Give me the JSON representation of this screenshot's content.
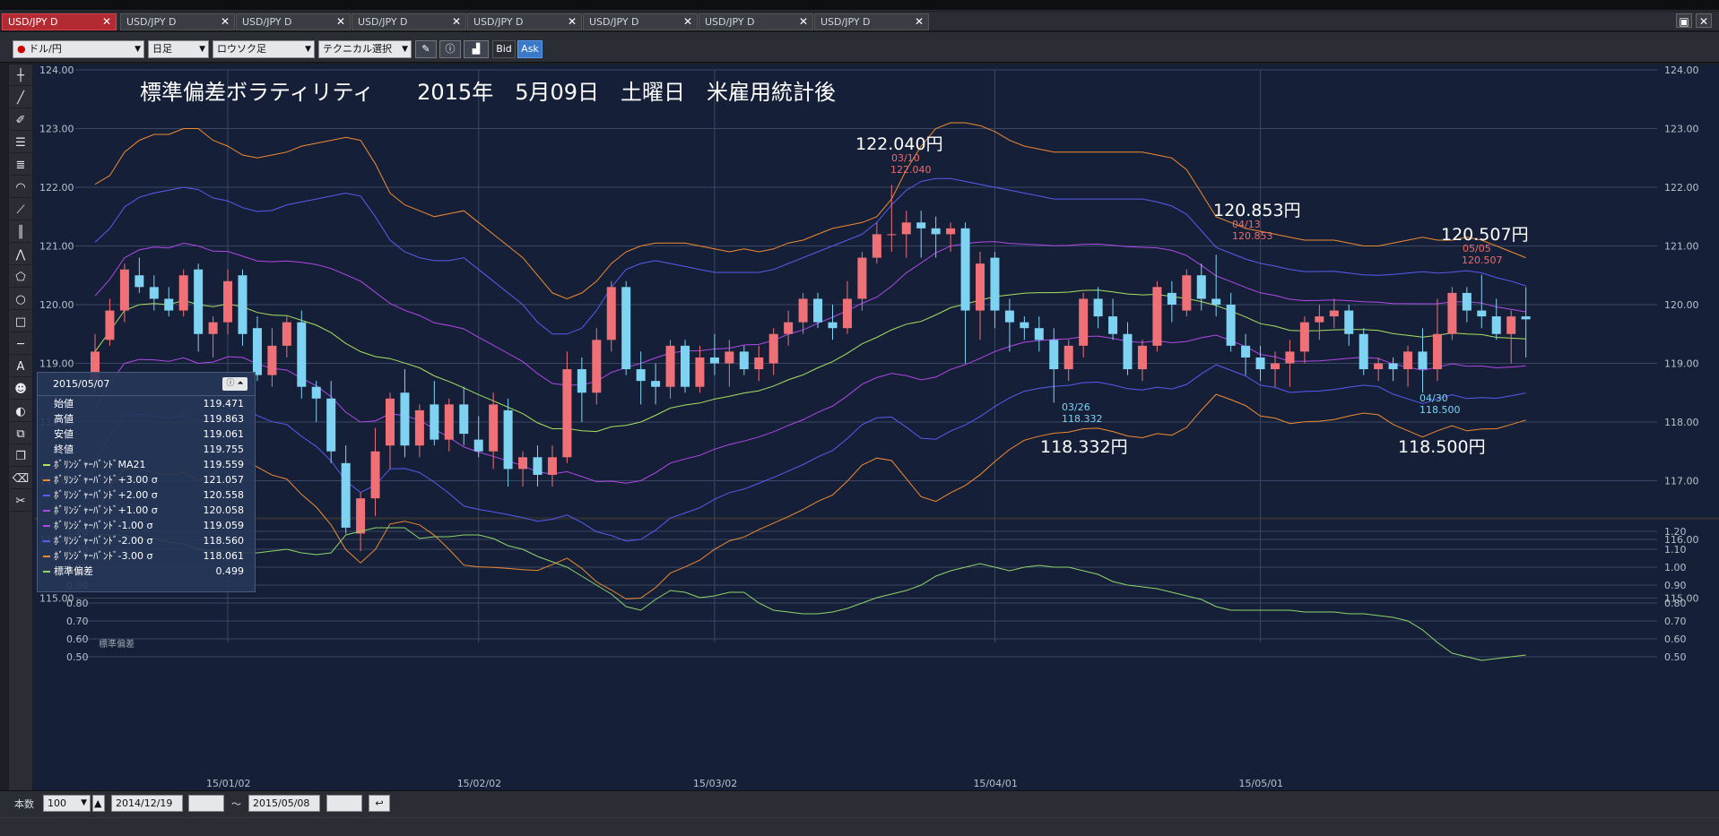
{
  "tabs": [
    {
      "label": "USD/JPY D",
      "active": true
    },
    {
      "label": "USD/JPY D",
      "active": false
    },
    {
      "label": "USD/JPY D",
      "active": false
    },
    {
      "label": "USD/JPY D",
      "active": false
    },
    {
      "label": "USD/JPY D",
      "active": false
    },
    {
      "label": "USD/JPY D",
      "active": false
    },
    {
      "label": "USD/JPY D",
      "active": false
    },
    {
      "label": "USD/JPY D",
      "active": false
    }
  ],
  "toolbar": {
    "pair": "ドル/円",
    "timeframe": "日足",
    "chart_type": "ロウソク足",
    "technical": "テクニカル選択",
    "bid_label": "Bid",
    "ask_label": "Ask"
  },
  "chart": {
    "title": "標準偏差ボラティリティ　　2015年　5月09日　土曜日　米雇用統計後",
    "price_ticks": [
      "124.00",
      "123.00",
      "122.00",
      "121.00",
      "120.00",
      "119.00",
      "118.00",
      "117.00",
      "116.00",
      "115.00"
    ],
    "sub_ticks": [
      "1.20",
      "1.10",
      "1.00",
      "0.90",
      "0.80",
      "0.70",
      "0.60",
      "0.50"
    ],
    "sub_label": "標準偏差",
    "date_ticks": [
      "15/01/02",
      "15/02/02",
      "15/03/02",
      "15/04/01",
      "15/05/01"
    ],
    "annotations": {
      "high1": {
        "big": "122.040円",
        "date": "03/10",
        "value": "122.040"
      },
      "low1": {
        "big": "118.332円",
        "date": "03/26",
        "value": "118.332"
      },
      "high2": {
        "big": "120.853円",
        "date": "04/13",
        "value": "120.853"
      },
      "high3": {
        "big": "120.507円",
        "date": "05/05",
        "value": "120.507"
      },
      "low2": {
        "big": "118.500円",
        "date": "04/30",
        "value": "118.500"
      }
    }
  },
  "colors": {
    "up": "#f07078",
    "down": "#7fd3f2",
    "band3": "#f08a30",
    "band2": "#5a5af0",
    "band1": "#b048e8",
    "ma": "#a8e060",
    "sd": "#8fd46a"
  },
  "chart_data": {
    "type": "candlestick",
    "xlabel": "",
    "ylabel": "",
    "ylim": [
      114.5,
      124.2
    ],
    "date_ticks": [
      "15/01/02",
      "15/02/02",
      "15/03/02",
      "15/04/01",
      "15/05/01"
    ],
    "candles": [
      [
        118.7,
        119.5,
        118.5,
        119.2
      ],
      [
        119.4,
        120.1,
        119.3,
        119.9
      ],
      [
        119.9,
        120.7,
        119.7,
        120.6
      ],
      [
        120.5,
        120.8,
        120.2,
        120.3
      ],
      [
        120.3,
        120.5,
        119.9,
        120.1
      ],
      [
        120.1,
        120.3,
        119.8,
        119.9
      ],
      [
        119.9,
        120.6,
        119.8,
        120.5
      ],
      [
        120.6,
        120.7,
        119.2,
        119.5
      ],
      [
        119.5,
        119.8,
        119.1,
        119.7
      ],
      [
        119.7,
        120.6,
        119.5,
        120.4
      ],
      [
        120.5,
        120.6,
        119.3,
        119.5
      ],
      [
        119.6,
        119.8,
        118.7,
        118.8
      ],
      [
        118.8,
        119.6,
        118.6,
        119.3
      ],
      [
        119.3,
        119.8,
        119.1,
        119.7
      ],
      [
        119.7,
        119.9,
        118.4,
        118.6
      ],
      [
        118.6,
        118.7,
        118.0,
        118.4
      ],
      [
        118.4,
        118.7,
        117.3,
        117.5
      ],
      [
        117.3,
        117.6,
        116.1,
        116.2
      ],
      [
        116.1,
        116.8,
        115.8,
        116.7
      ],
      [
        116.7,
        117.9,
        116.4,
        117.5
      ],
      [
        117.6,
        118.5,
        117.2,
        118.4
      ],
      [
        118.5,
        118.9,
        117.4,
        117.6
      ],
      [
        117.6,
        118.3,
        117.4,
        118.2
      ],
      [
        118.3,
        118.7,
        117.6,
        117.7
      ],
      [
        117.7,
        118.4,
        117.5,
        118.3
      ],
      [
        118.3,
        118.6,
        117.6,
        117.8
      ],
      [
        117.7,
        118.1,
        117.4,
        117.5
      ],
      [
        117.5,
        118.5,
        117.2,
        118.3
      ],
      [
        118.2,
        118.4,
        116.9,
        117.2
      ],
      [
        117.2,
        117.5,
        116.9,
        117.4
      ],
      [
        117.4,
        117.6,
        116.9,
        117.1
      ],
      [
        117.1,
        117.6,
        116.9,
        117.4
      ],
      [
        117.4,
        119.2,
        117.3,
        118.9
      ],
      [
        118.9,
        119.1,
        118.0,
        118.5
      ],
      [
        118.5,
        119.6,
        118.3,
        119.4
      ],
      [
        119.4,
        120.4,
        119.2,
        120.3
      ],
      [
        120.3,
        120.4,
        118.8,
        118.9
      ],
      [
        118.9,
        119.2,
        118.3,
        118.7
      ],
      [
        118.7,
        119.0,
        118.3,
        118.6
      ],
      [
        118.6,
        119.4,
        118.4,
        119.3
      ],
      [
        119.3,
        119.4,
        118.5,
        118.6
      ],
      [
        118.6,
        119.3,
        118.5,
        119.1
      ],
      [
        119.1,
        119.5,
        118.8,
        119.0
      ],
      [
        119.0,
        119.4,
        118.6,
        119.2
      ],
      [
        119.2,
        119.3,
        118.8,
        118.9
      ],
      [
        118.9,
        119.3,
        118.7,
        119.1
      ],
      [
        119.0,
        119.6,
        118.8,
        119.5
      ],
      [
        119.5,
        119.9,
        119.3,
        119.7
      ],
      [
        119.7,
        120.2,
        119.5,
        120.1
      ],
      [
        120.1,
        120.2,
        119.6,
        119.7
      ],
      [
        119.7,
        120.0,
        119.4,
        119.6
      ],
      [
        119.6,
        120.4,
        119.5,
        120.1
      ],
      [
        120.1,
        120.9,
        119.9,
        120.8
      ],
      [
        120.8,
        121.4,
        120.7,
        121.2
      ],
      [
        121.2,
        122.04,
        120.9,
        121.2
      ],
      [
        121.2,
        121.6,
        120.8,
        121.4
      ],
      [
        121.4,
        121.6,
        120.8,
        121.3
      ],
      [
        121.3,
        121.5,
        120.8,
        121.2
      ],
      [
        121.2,
        121.4,
        120.9,
        121.3
      ],
      [
        121.3,
        121.4,
        119.0,
        119.9
      ],
      [
        119.9,
        120.9,
        119.4,
        120.7
      ],
      [
        120.8,
        120.9,
        119.6,
        119.9
      ],
      [
        119.9,
        120.1,
        119.2,
        119.7
      ],
      [
        119.7,
        119.8,
        119.4,
        119.6
      ],
      [
        119.6,
        119.8,
        119.2,
        119.4
      ],
      [
        119.4,
        119.6,
        118.33,
        118.9
      ],
      [
        118.9,
        119.4,
        118.7,
        119.3
      ],
      [
        119.3,
        120.2,
        119.1,
        120.1
      ],
      [
        120.1,
        120.3,
        119.6,
        119.8
      ],
      [
        119.8,
        120.1,
        119.4,
        119.5
      ],
      [
        119.5,
        119.7,
        118.8,
        118.9
      ],
      [
        118.9,
        119.4,
        118.7,
        119.3
      ],
      [
        119.3,
        120.4,
        119.2,
        120.3
      ],
      [
        120.2,
        120.4,
        119.7,
        120.0
      ],
      [
        119.9,
        120.6,
        119.8,
        120.5
      ],
      [
        120.5,
        120.7,
        119.9,
        120.1
      ],
      [
        120.1,
        120.85,
        119.8,
        120.0
      ],
      [
        120.0,
        120.2,
        119.2,
        119.3
      ],
      [
        119.3,
        119.5,
        118.8,
        119.1
      ],
      [
        119.1,
        119.3,
        118.7,
        118.9
      ],
      [
        118.9,
        119.2,
        118.6,
        119.0
      ],
      [
        119.0,
        119.4,
        118.6,
        119.2
      ],
      [
        119.2,
        119.8,
        119.0,
        119.7
      ],
      [
        119.7,
        120.0,
        119.4,
        119.8
      ],
      [
        119.8,
        120.1,
        119.6,
        119.9
      ],
      [
        119.9,
        120.0,
        119.3,
        119.5
      ],
      [
        119.5,
        119.6,
        118.8,
        118.9
      ],
      [
        118.9,
        119.1,
        118.7,
        119.0
      ],
      [
        119.0,
        119.1,
        118.7,
        118.9
      ],
      [
        118.9,
        119.3,
        118.6,
        119.2
      ],
      [
        119.2,
        119.6,
        118.5,
        118.9
      ],
      [
        118.9,
        120.1,
        118.7,
        119.5
      ],
      [
        119.5,
        120.3,
        119.4,
        120.2
      ],
      [
        120.2,
        120.3,
        119.7,
        119.9
      ],
      [
        119.9,
        120.51,
        119.6,
        119.8
      ],
      [
        119.8,
        120.1,
        119.4,
        119.5
      ],
      [
        119.5,
        119.9,
        119.0,
        119.8
      ],
      [
        119.8,
        120.3,
        119.1,
        119.75
      ]
    ],
    "bands": {
      "plus3": [
        122.05,
        122.2,
        122.6,
        122.8,
        122.9,
        122.9,
        123.0,
        123.0,
        122.8,
        122.7,
        122.55,
        122.5,
        122.55,
        122.6,
        122.7,
        122.75,
        122.8,
        122.85,
        122.8,
        122.4,
        121.9,
        121.7,
        121.6,
        121.5,
        121.55,
        121.6,
        121.4,
        121.2,
        121.0,
        120.8,
        120.5,
        120.2,
        120.1,
        120.2,
        120.4,
        120.7,
        120.9,
        121.0,
        121.05,
        121.05,
        121.05,
        121.0,
        120.95,
        120.9,
        120.95,
        120.9,
        120.95,
        121.05,
        121.1,
        121.2,
        121.3,
        121.35,
        121.4,
        121.5,
        121.8,
        122.3,
        122.7,
        123.0,
        123.1,
        123.1,
        123.05,
        122.95,
        122.8,
        122.7,
        122.65,
        122.6,
        122.6,
        122.6,
        122.6,
        122.6,
        122.6,
        122.6,
        122.55,
        122.5,
        122.3,
        121.9,
        121.5,
        121.4,
        121.3,
        121.25,
        121.2,
        121.15,
        121.1,
        121.1,
        121.1,
        121.05,
        121.0,
        121.0,
        121.05,
        121.1,
        121.15,
        121.1,
        121.1,
        121.15,
        121.1,
        121.0,
        120.9,
        120.8
      ],
      "plus2": [
        121.0,
        121.3,
        121.6,
        121.8,
        121.9,
        121.95,
        122.0,
        121.95,
        121.8,
        121.7,
        121.6,
        121.55,
        121.6,
        121.7,
        121.75,
        121.8,
        121.85,
        121.9,
        121.85,
        121.5,
        121.1,
        120.9,
        120.8,
        120.75,
        120.75,
        120.8,
        120.6,
        120.4,
        120.2,
        120.0,
        119.7,
        119.5,
        119.5,
        119.6,
        119.9,
        120.3,
        120.6,
        120.7,
        120.75,
        120.7,
        120.65,
        120.6,
        120.55,
        120.55,
        120.55,
        120.55,
        120.6,
        120.7,
        120.8,
        120.9,
        121.0,
        121.1,
        121.2,
        121.4,
        121.7,
        121.95,
        122.1,
        122.15,
        122.15,
        122.1,
        122.05,
        122.0,
        121.95,
        121.9,
        121.85,
        121.8,
        121.8,
        121.8,
        121.8,
        121.8,
        121.8,
        121.8,
        121.75,
        121.65,
        121.45,
        121.2,
        120.95,
        120.8,
        120.7,
        120.6,
        120.55,
        120.5,
        120.45,
        120.4,
        120.4,
        120.4,
        120.35,
        120.35,
        120.4,
        120.45,
        120.5,
        120.5,
        120.5,
        120.5,
        120.5,
        120.45,
        120.4,
        120.3
      ]
    },
    "std_dev": [
      1.18,
      1.18,
      1.18,
      1.15,
      1.16,
      1.14,
      1.13,
      1.1,
      1.09,
      1.09,
      1.08,
      1.08,
      1.09,
      1.1,
      1.08,
      1.07,
      1.08,
      1.18,
      1.2,
      1.22,
      1.22,
      1.22,
      1.16,
      1.17,
      1.17,
      1.18,
      1.18,
      1.16,
      1.12,
      1.1,
      1.06,
      1.03,
      1.0,
      0.95,
      0.9,
      0.85,
      0.78,
      0.76,
      0.82,
      0.87,
      0.86,
      0.83,
      0.84,
      0.86,
      0.86,
      0.8,
      0.76,
      0.75,
      0.74,
      0.74,
      0.75,
      0.77,
      0.8,
      0.83,
      0.85,
      0.87,
      0.9,
      0.95,
      0.98,
      1.0,
      1.02,
      1.0,
      0.98,
      1.0,
      1.01,
      1.0,
      1.0,
      0.98,
      0.96,
      0.92,
      0.9,
      0.89,
      0.88,
      0.86,
      0.84,
      0.82,
      0.78,
      0.76,
      0.76,
      0.76,
      0.76,
      0.76,
      0.75,
      0.75,
      0.75,
      0.74,
      0.74,
      0.73,
      0.72,
      0.7,
      0.65,
      0.58,
      0.52,
      0.5,
      0.48,
      0.49,
      0.5,
      0.51
    ]
  },
  "info": {
    "date": "2015/05/07",
    "rows": [
      {
        "label": "始値",
        "value": "119.471",
        "color": ""
      },
      {
        "label": "高値",
        "value": "119.863",
        "color": ""
      },
      {
        "label": "安値",
        "value": "119.061",
        "color": ""
      },
      {
        "label": "終値",
        "value": "119.755",
        "color": ""
      },
      {
        "label": "ﾎﾞﾘﾝｼﾞｬｰﾊﾞﾝﾄﾞMA21",
        "value": "119.559",
        "color": "#a8e060"
      },
      {
        "label": "ﾎﾞﾘﾝｼﾞｬｰﾊﾞﾝﾄﾞ+3.00 σ",
        "value": "121.057",
        "color": "#f08a30"
      },
      {
        "label": "ﾎﾞﾘﾝｼﾞｬｰﾊﾞﾝﾄﾞ+2.00 σ",
        "value": "120.558",
        "color": "#5a5af0"
      },
      {
        "label": "ﾎﾞﾘﾝｼﾞｬｰﾊﾞﾝﾄﾞ+1.00 σ",
        "value": "120.058",
        "color": "#b048e8"
      },
      {
        "label": "ﾎﾞﾘﾝｼﾞｬｰﾊﾞﾝﾄﾞ-1.00 σ",
        "value": "119.059",
        "color": "#b048e8"
      },
      {
        "label": "ﾎﾞﾘﾝｼﾞｬｰﾊﾞﾝﾄﾞ-2.00 σ",
        "value": "118.560",
        "color": "#5a5af0"
      },
      {
        "label": "ﾎﾞﾘﾝｼﾞｬｰﾊﾞﾝﾄﾞ-3.00 σ",
        "value": "118.061",
        "color": "#f08a30"
      },
      {
        "label": "標準偏差",
        "value": "0.499",
        "color": "#8fd46a"
      }
    ]
  },
  "footer": {
    "count_label": "本数",
    "count": "100",
    "start_date": "2014/12/19",
    "tilde": "～",
    "end_date": "2015/05/08"
  }
}
